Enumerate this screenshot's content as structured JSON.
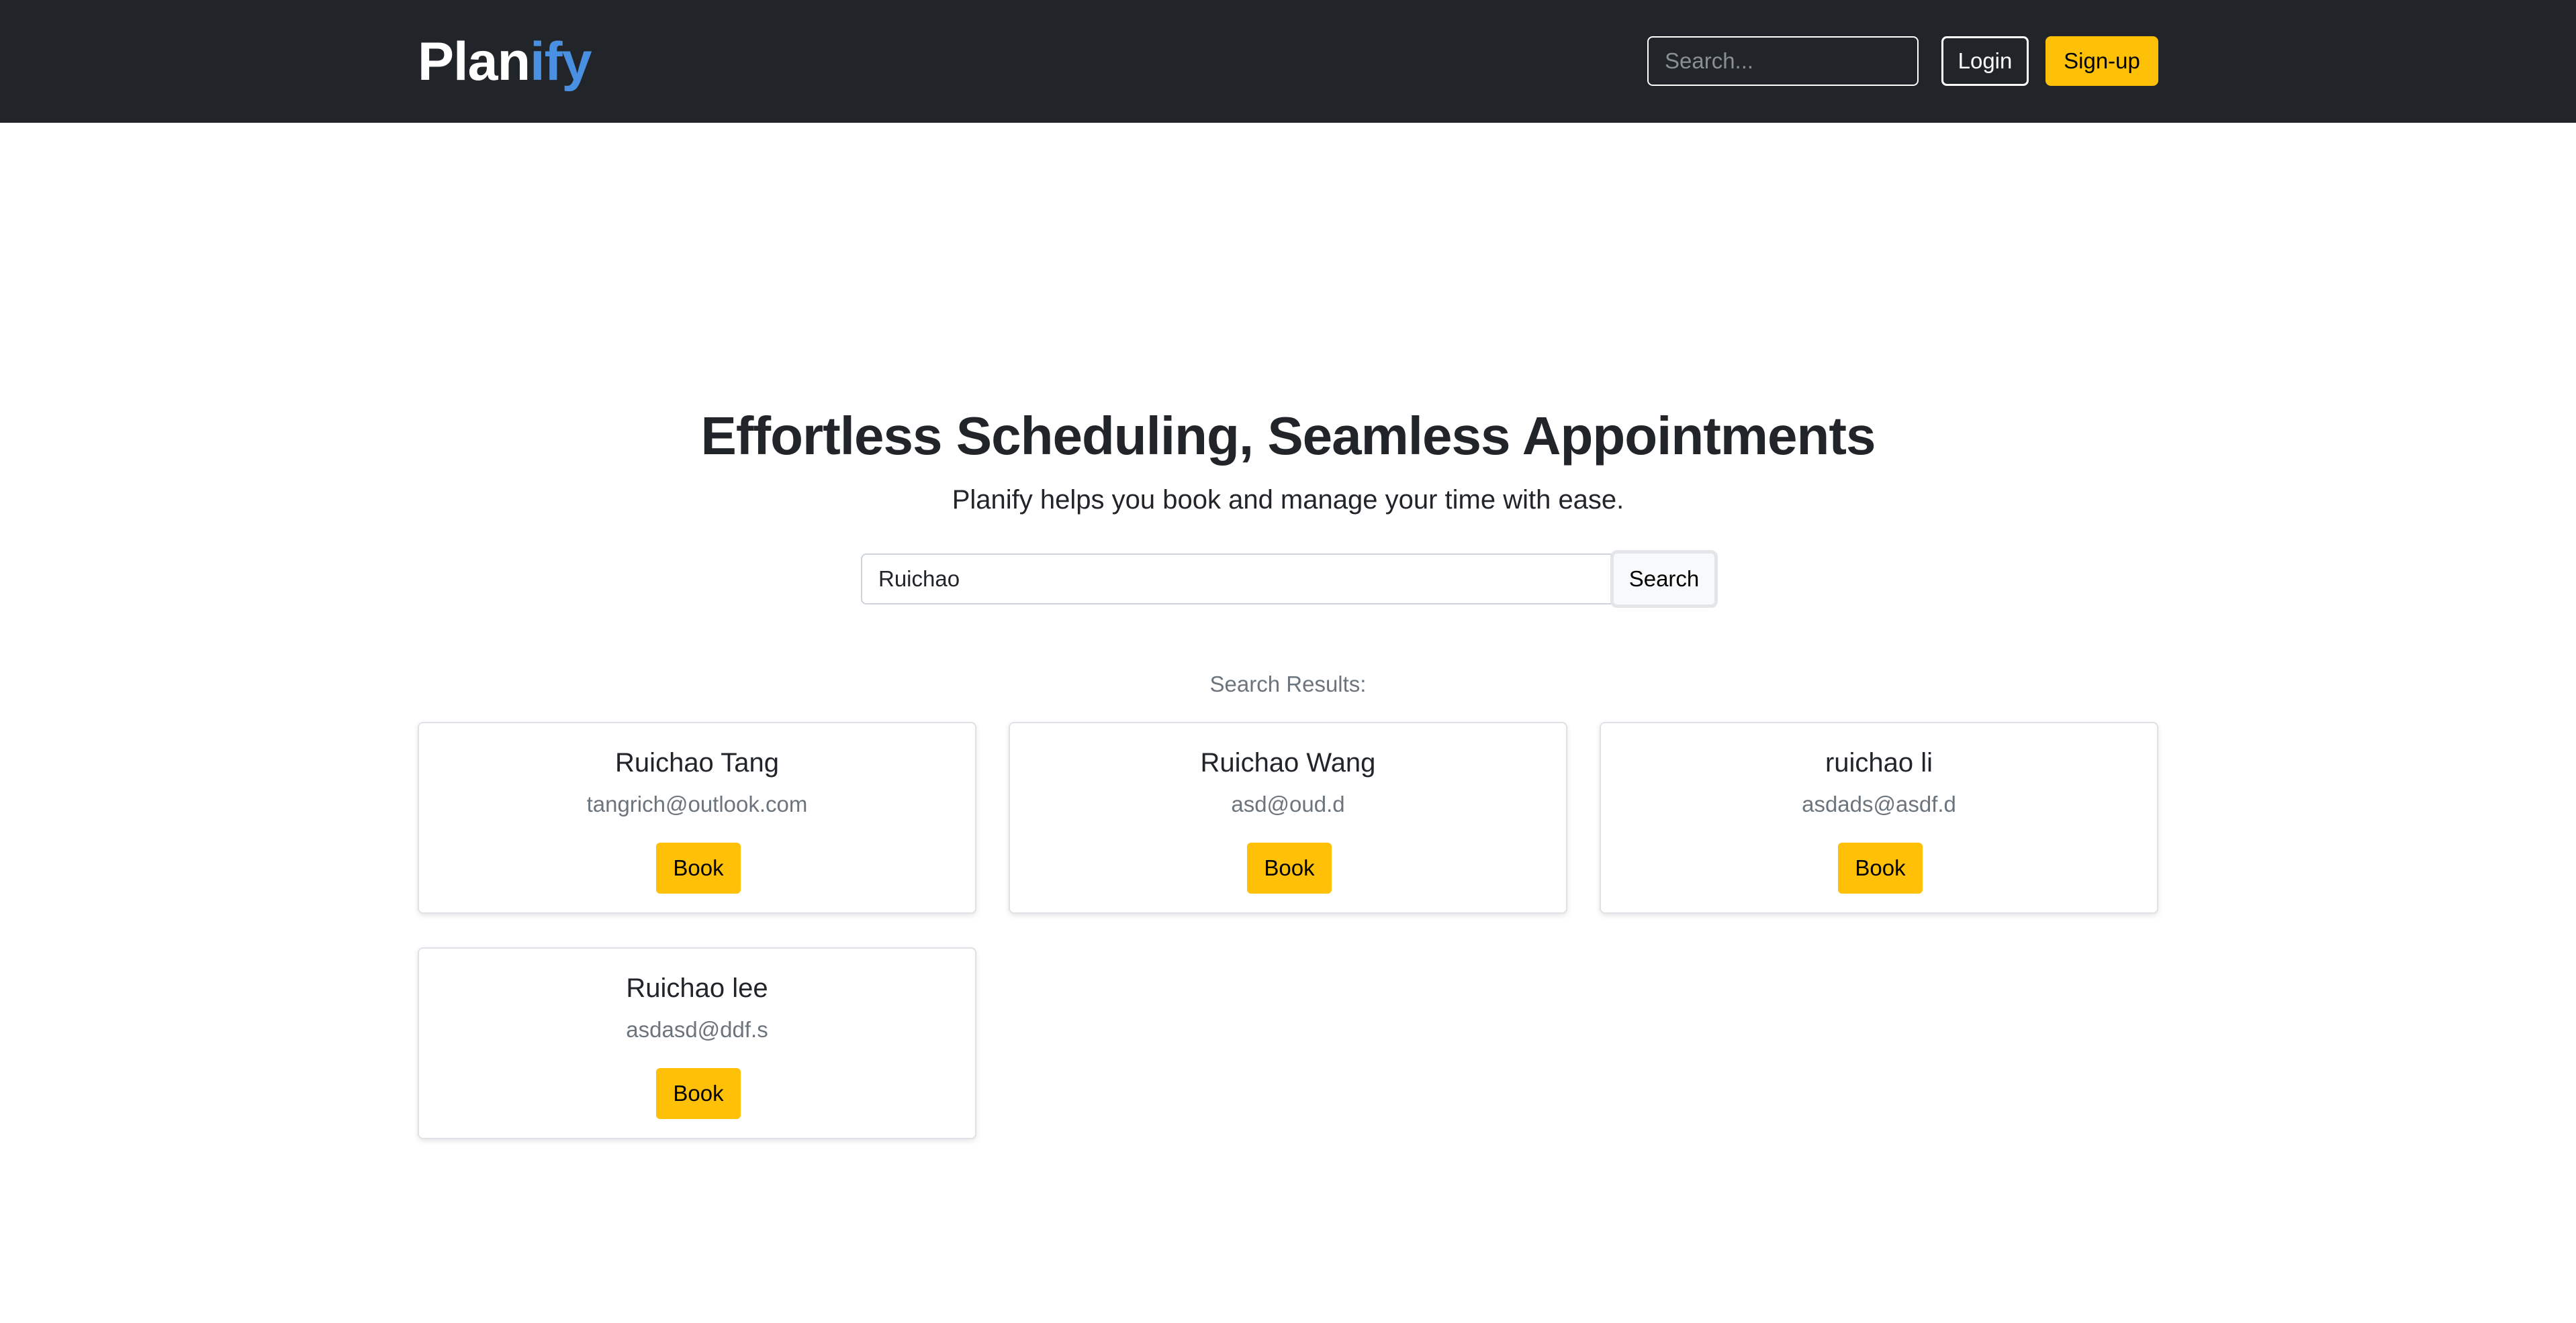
{
  "brand": {
    "name_main": "Plan",
    "name_accent": "ify",
    "accent_color": "#4a90e2"
  },
  "nav": {
    "search_placeholder": "Search...",
    "login_label": "Login",
    "signup_label": "Sign-up",
    "background_color": "#212529",
    "signup_color": "#ffc107"
  },
  "hero": {
    "title": "Effortless Scheduling, Seamless Appointments",
    "subtitle": "Planify helps you book and manage your time with ease."
  },
  "search": {
    "value": "Ruichao",
    "button_label": "Search"
  },
  "results": {
    "label": "Search Results:",
    "items": [
      {
        "name": "Ruichao Tang",
        "email": "tangrich@outlook.com",
        "button_label": "Book"
      },
      {
        "name": "Ruichao Wang",
        "email": "asd@oud.d",
        "button_label": "Book"
      },
      {
        "name": "ruichao li",
        "email": "asdads@asdf.d",
        "button_label": "Book"
      },
      {
        "name": "Ruichao lee",
        "email": "asdasd@ddf.s",
        "button_label": "Book"
      }
    ]
  }
}
